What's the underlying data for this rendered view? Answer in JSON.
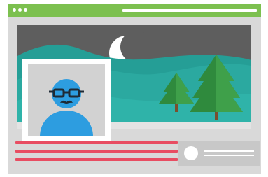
{
  "window": {
    "title_bar_color": "#7cc04f",
    "dots": 3
  },
  "banner": {
    "sky_color": "#5e5e5e",
    "moon_icon": "crescent-moon",
    "hills_color": "#2ba9a0",
    "trees_color": "#2f8a3d",
    "tree_count": 2
  },
  "profile": {
    "avatar_icon": "user-avatar-with-glasses-and-mustache",
    "avatar_color": "#2d9de0"
  },
  "text_lines": {
    "count": 3,
    "color": "#e84d62"
  },
  "info_card": {
    "icon": "circle-placeholder",
    "lines": 2
  }
}
